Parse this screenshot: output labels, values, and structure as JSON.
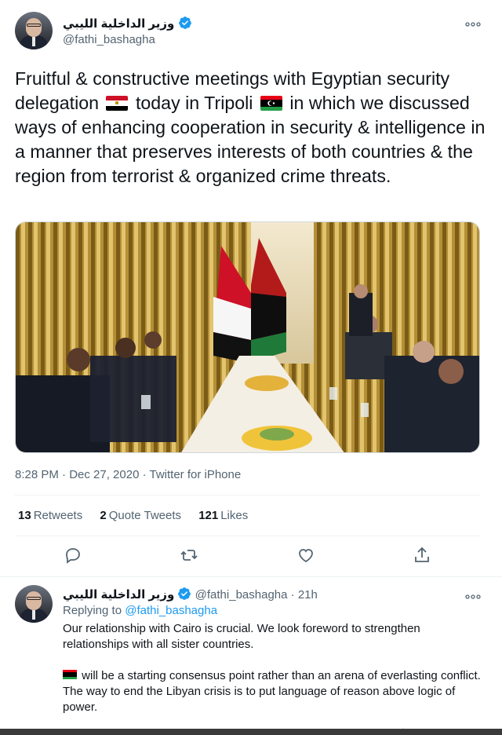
{
  "main_tweet": {
    "author_name": "وزير الداخلية الليبي",
    "author_handle": "@fathi_bashagha",
    "text_segments": {
      "part1": "Fruitful & constructive meetings with Egyptian security delegation",
      "part2": "today in Tripoli",
      "part3": "in which we discussed ways of enhancing cooperation in security & intelligence in a manner that preserves interests of both countries & the region from terrorist & organized crime threats."
    },
    "timestamp": "8:28 PM · Dec 27, 2020 · Twitter for iPhone",
    "stats": {
      "retweets_count": "13",
      "retweets_label": "Retweets",
      "quotes_count": "2",
      "quotes_label": "Quote Tweets",
      "likes_count": "121",
      "likes_label": "Likes"
    }
  },
  "reply_tweet": {
    "author_name": "وزير الداخلية الليبي",
    "author_handle": "@fathi_bashagha",
    "time_ago": "21h",
    "replying_to_label": "Replying to",
    "replying_to_handle": "@fathi_bashagha",
    "paragraph1": "Our relationship with Cairo is crucial. We look foreword to strengthen relationships with all sister countries.",
    "paragraph2": "will be a starting consensus point rather than an arena of everlasting conflict. The way to end the Libyan crisis is to put language of reason above logic of power."
  },
  "icons": {
    "verified": "verified-badge-icon",
    "more": "more-options-icon",
    "reply": "reply-icon",
    "retweet": "retweet-icon",
    "like": "like-icon",
    "share": "share-icon"
  },
  "colors": {
    "accent": "#1d9bf0",
    "secondary_text": "#536471",
    "primary_text": "#0f1419"
  }
}
